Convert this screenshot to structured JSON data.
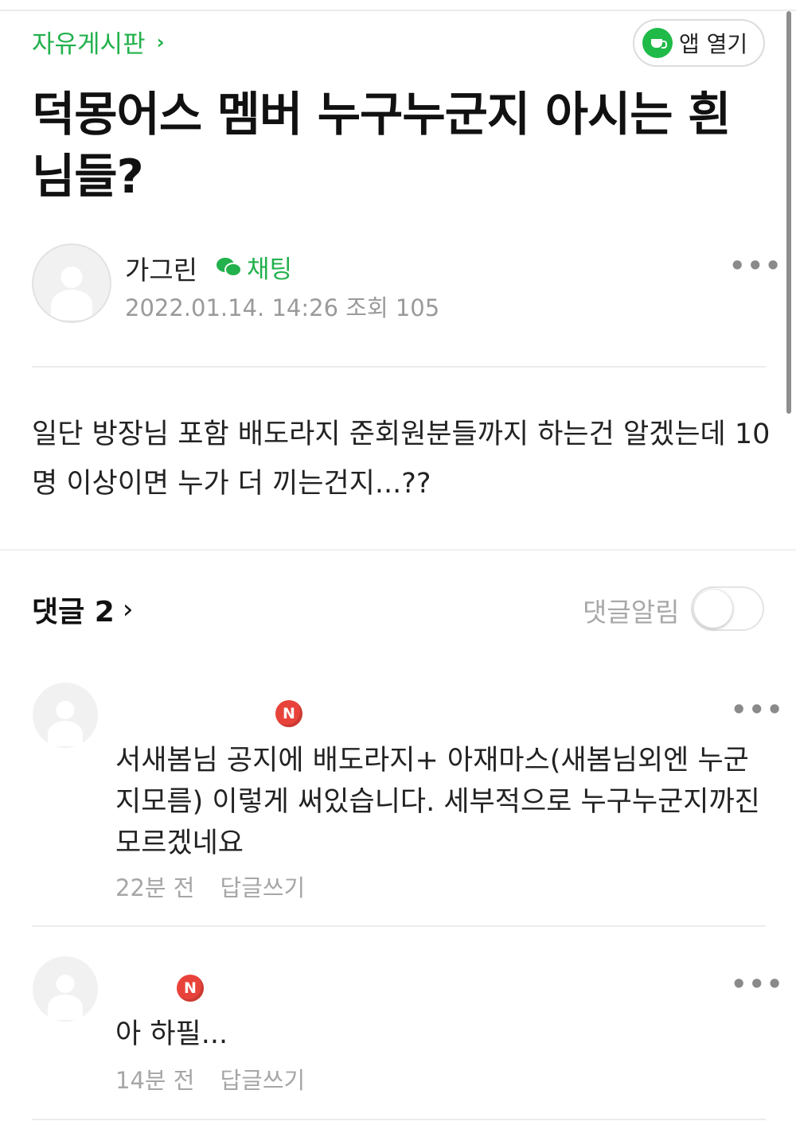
{
  "header": {
    "board_name": "자유게시판",
    "board_chevron": "›",
    "app_open_label": "앱 열기",
    "app_icon": "cafe-cup-icon"
  },
  "post": {
    "title": "덕몽어스 멤버 누구누군지 아시는 흰님들?",
    "author": "가그린",
    "chat_label": "채팅",
    "chat_icon": "chat-bubbles-icon",
    "meta": "2022.01.14. 14:26 조회 105",
    "more": "•••",
    "body": "일단 방장님 포함 배도라지 준회원분들까지 하는건 알겠는데 10명 이상이면 누가 더 끼는건지...??"
  },
  "comments_section": {
    "title": "댓글 2",
    "chevron": "›",
    "alarm_label": "댓글알림",
    "alarm_on": false
  },
  "comments": [
    {
      "badge": "N",
      "text": "서새봄님 공지에 배도라지+ 아재마스(새봄님외엔 누군지모름) 이렇게 써있습니다. 세부적으로 누구누군지까진모르겠네요",
      "time": "22분 전",
      "reply": "답글쓰기",
      "more": "•••"
    },
    {
      "badge": "N",
      "text": "아 하필...",
      "time": "14분 전",
      "reply": "답글쓰기",
      "more": "•••"
    }
  ],
  "colors": {
    "accent_green": "#22b14c",
    "badge_red": "#e8433a",
    "meta_gray": "#9a9a9a"
  }
}
